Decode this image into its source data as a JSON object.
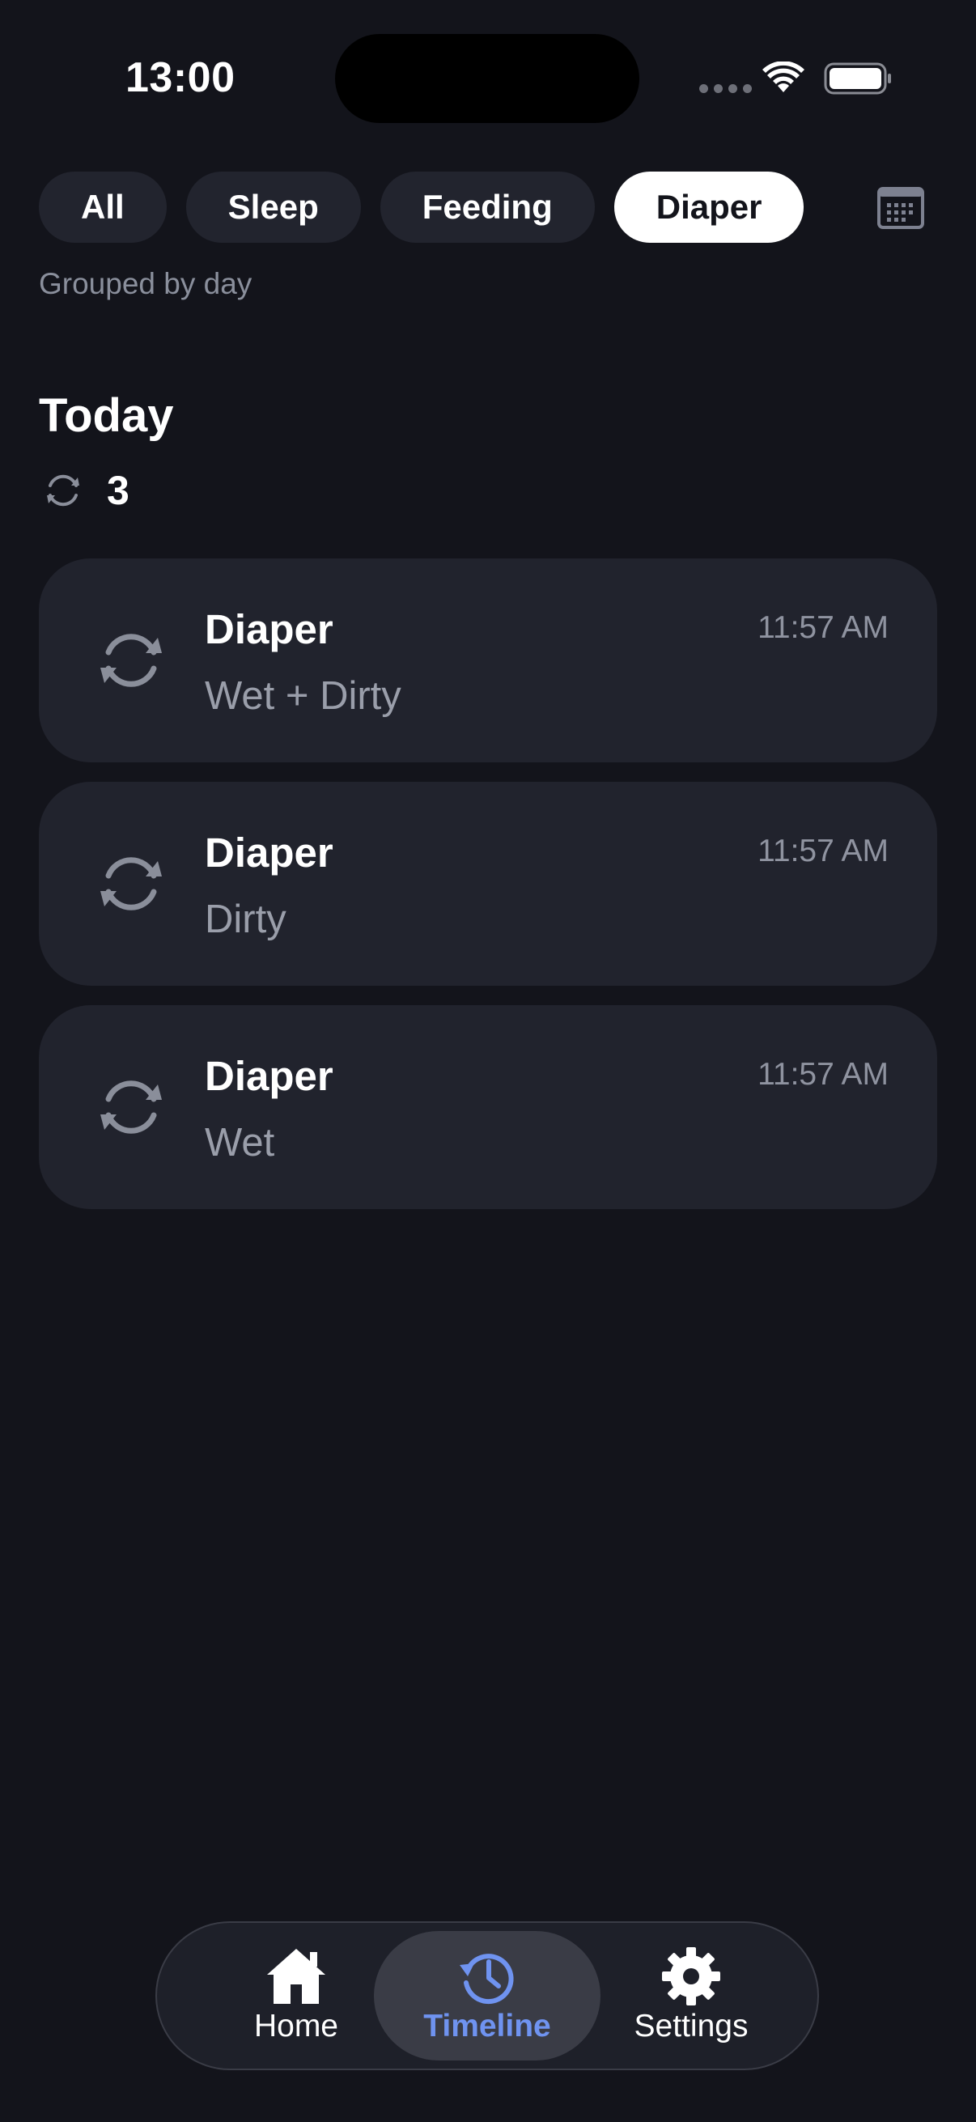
{
  "status_bar": {
    "time": "13:00"
  },
  "filters": {
    "chips": [
      {
        "label": "All",
        "selected": false
      },
      {
        "label": "Sleep",
        "selected": false
      },
      {
        "label": "Feeding",
        "selected": false
      },
      {
        "label": "Diaper",
        "selected": true
      }
    ],
    "calendar_icon": "calendar-icon",
    "grouping_label": "Grouped by day"
  },
  "section": {
    "title": "Today",
    "summary_icon": "diaper-change-icon",
    "summary_count": "3"
  },
  "events": [
    {
      "icon": "diaper-change-icon",
      "title": "Diaper",
      "detail": "Wet + Dirty",
      "time": "11:57 AM"
    },
    {
      "icon": "diaper-change-icon",
      "title": "Diaper",
      "detail": "Dirty",
      "time": "11:57 AM"
    },
    {
      "icon": "diaper-change-icon",
      "title": "Diaper",
      "detail": "Wet",
      "time": "11:57 AM"
    }
  ],
  "tabbar": {
    "tabs": [
      {
        "label": "Home",
        "icon": "home-icon",
        "active": false
      },
      {
        "label": "Timeline",
        "icon": "history-icon",
        "active": true
      },
      {
        "label": "Settings",
        "icon": "gear-icon",
        "active": false
      }
    ]
  },
  "colors": {
    "background": "#13141b",
    "card": "#21232d",
    "accent": "#6f93f0",
    "secondary_text": "#9a9eaa"
  }
}
